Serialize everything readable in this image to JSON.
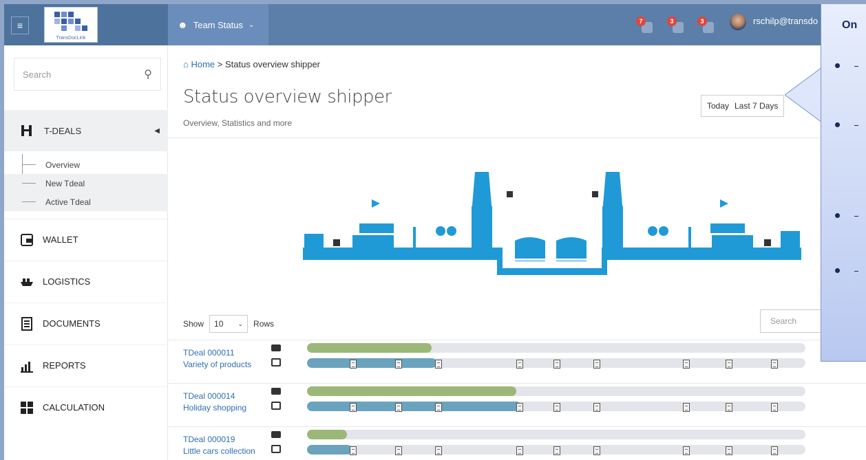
{
  "topbar": {
    "menu_icon": "hamburger-icon",
    "logo_text": "TransDocLink",
    "team_label": "Team Status",
    "notifications": [
      {
        "icon": "alarm-icon",
        "count": "7"
      },
      {
        "icon": "mail-icon",
        "count": "3"
      },
      {
        "icon": "task-icon",
        "count": "3"
      }
    ],
    "user": "rschilp@transdo"
  },
  "sidebar": {
    "search_placeholder": "Search",
    "section": "T-DEALS",
    "sub_items": [
      "Overview",
      "New Tdeal",
      "Active Tdeal"
    ],
    "items": [
      {
        "label": "WALLET",
        "icon": "wallet-icon"
      },
      {
        "label": "LOGISTICS",
        "icon": "ship-icon"
      },
      {
        "label": "DOCUMENTS",
        "icon": "document-icon"
      },
      {
        "label": "REPORTS",
        "icon": "chart-icon"
      },
      {
        "label": "CALCULATION",
        "icon": "calculator-icon"
      }
    ]
  },
  "main": {
    "breadcrumb_home": "Home",
    "breadcrumb_sep": ">",
    "breadcrumb_current": "Status overview shipper",
    "title": "Status overview shipper",
    "subtitle": "Overview, Statistics and more",
    "date_buttons": [
      "Today",
      "Last 7 Days"
    ],
    "show_label": "Show",
    "rows_value": "10",
    "rows_label": "Rows",
    "table_search": "Search"
  },
  "deals": [
    {
      "id": "TDeal 000011",
      "name": "Variety of products",
      "progress_green": 0.25,
      "progress_blue": 0.26
    },
    {
      "id": "TDeal 000014",
      "name": "Holiday shopping",
      "progress_green": 0.42,
      "progress_blue": 0.43
    },
    {
      "id": "TDeal 000019",
      "name": "Little cars collection",
      "progress_green": 0.08,
      "progress_blue": 0.09
    }
  ],
  "callout": {
    "title_fragment": "On"
  },
  "colors": {
    "topbar": "#5b7fa8",
    "accent": "#2f6fb0",
    "green": "#9bb878",
    "blue": "#6aa3bd",
    "banner": "#1f9ad6"
  }
}
